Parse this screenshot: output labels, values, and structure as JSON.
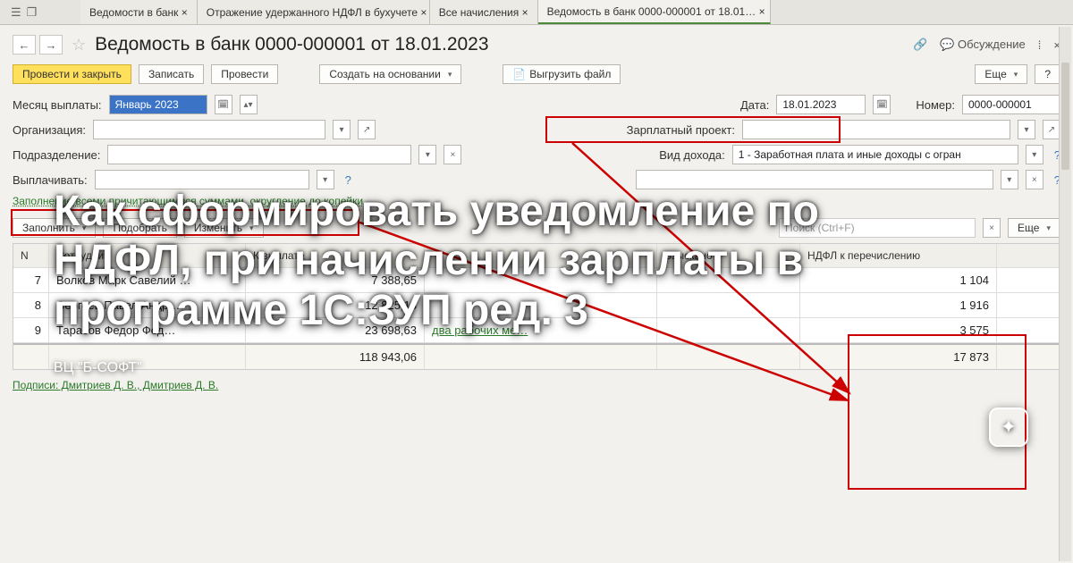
{
  "tabs": {
    "t1": "Ведомости в банк ×",
    "t2": "Отражение удержанного НДФЛ в бухучете ×",
    "t3": "Все начисления ×",
    "t4": "Ведомость в банк 0000-000001 от 18.01… ×"
  },
  "title": "Ведомость в банк 0000-000001 от 18.01.2023",
  "titlebar": {
    "discuss": "Обсуждение"
  },
  "toolbar": {
    "post_close": "Провести и закрыть",
    "save": "Записать",
    "post": "Провести",
    "create_based": "Создать на основании",
    "export": "Выгрузить файл",
    "more": "Еще"
  },
  "form": {
    "month_label": "Месяц выплаты:",
    "month_value": "Январь 2023",
    "date_label": "Дата:",
    "date_value": "18.01.2023",
    "number_label": "Номер:",
    "number_value": "0000-000001",
    "org_label": "Организация:",
    "proj_label": "Зарплатный проект:",
    "dept_label": "Подразделение:",
    "income_label": "Вид дохода:",
    "income_value": "1 - Заработная плата и иные доходы с огран",
    "payto_label": "Выплачивать:",
    "docbasis_label": " ",
    "fill_hint": "Заполнение всеми причитающимися суммами, округление до копейки",
    "fill_btn": "Заполнить",
    "pick_btn": "Подобрать",
    "change_btn": "Изменить",
    "search_ph": "Поиск (Ctrl+F)"
  },
  "table": {
    "headers": {
      "n": "N",
      "emp": "Сотрудник",
      "pay": "К выплате",
      "extra": "",
      "charged": "Взыскано",
      "ndfl": "НДФЛ к перечислению"
    },
    "rows": [
      {
        "n": "7",
        "emp": "Волков Марк Савелий …",
        "pay": "7 388,65",
        "extra": "",
        "charged": "",
        "ndfl": "1 104"
      },
      {
        "n": "8",
        "emp": "Сергеев Павел Андр…",
        "pay": "12 825,18",
        "extra": "",
        "charged": "",
        "ndfl": "1 916"
      },
      {
        "n": "9",
        "emp": "Тарасов Федор Фед…",
        "pay": "23 698,63",
        "extra": "два рабочих ме…",
        "charged": "",
        "ndfl": "3 575"
      }
    ],
    "totals": {
      "pay": "118 943,06",
      "ndfl": "17 873"
    }
  },
  "footer": {
    "sign": "Подписи:  Дмитриев Д. В., Дмитриев Д. В."
  },
  "overlay": {
    "heading": "Как сформировать уведомление по НДФЛ, при начислении зарплаты в программе 1С:ЗУП ред. 3",
    "author": "ВЦ \"Б-СОФТ\""
  }
}
